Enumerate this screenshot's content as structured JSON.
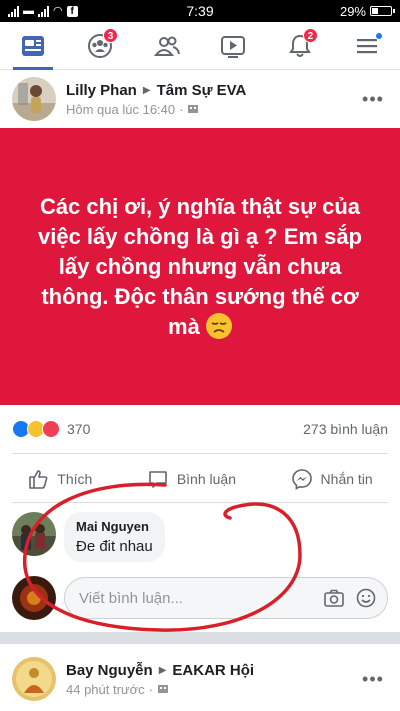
{
  "statusbar": {
    "carrier_icons": "signal-wifi-facebook",
    "time": "7:39",
    "battery": "29%"
  },
  "navbar": {
    "items": [
      {
        "name": "news-feed",
        "badge": ""
      },
      {
        "name": "groups",
        "badge": "3"
      },
      {
        "name": "friends",
        "badge": ""
      },
      {
        "name": "watch",
        "badge": ""
      },
      {
        "name": "notifications",
        "badge": "2"
      },
      {
        "name": "menu",
        "badge": ""
      }
    ]
  },
  "post1": {
    "author": "Lilly Phan",
    "group": "Tâm Sự EVA",
    "time": "Hôm qua lúc 16:40",
    "status_text": "Các chị ơi, ý nghĩa thật sự của việc lấy chồng là gì ạ ? Em sắp lấy chồng nhưng vẫn chưa thông. Độc thân sướng thế cơ mà",
    "status_bg_color": "#e0173d",
    "reaction_count": "370",
    "comment_count": "273 bình luận",
    "actions": {
      "like": "Thích",
      "comment": "Bình luận",
      "message": "Nhắn tin"
    },
    "comment": {
      "author": "Mai Nguyen",
      "text": "Đe đit nhau"
    },
    "write_placeholder": "Viết bình luận..."
  },
  "post2": {
    "author": "Bay Nguyễn",
    "group": "EAKAR Hội",
    "time": "44 phút trước"
  },
  "colors": {
    "facebook_blue": "#4267b2",
    "badge_red": "#f02849",
    "annotation_red": "#d81f2a"
  }
}
